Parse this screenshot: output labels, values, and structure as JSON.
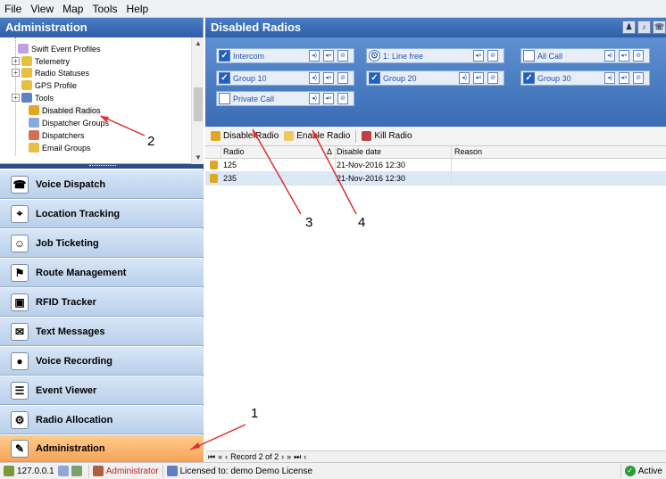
{
  "menu": [
    "File",
    "View",
    "Map",
    "Tools",
    "Help"
  ],
  "left_panel": {
    "title": "Administration",
    "tree": [
      {
        "label": "Swift Event Profiles",
        "icon": "event-profile-icon"
      },
      {
        "label": "Telemetry",
        "icon": "telemetry-icon"
      },
      {
        "label": "Radio Statuses",
        "icon": "radio-status-icon"
      },
      {
        "label": "GPS Profile",
        "icon": "gps-profile-icon"
      },
      {
        "label": "Tools",
        "icon": "tools-icon"
      },
      {
        "label": "Disabled Radios",
        "icon": "lock-icon"
      },
      {
        "label": "Dispatcher Groups",
        "icon": "dispatcher-groups-icon"
      },
      {
        "label": "Dispatchers",
        "icon": "dispatchers-icon"
      },
      {
        "label": "Email Groups",
        "icon": "email-groups-icon"
      }
    ],
    "nav": [
      {
        "label": "Voice Dispatch",
        "icon": "voice-dispatch-icon"
      },
      {
        "label": "Location Tracking",
        "icon": "location-tracking-icon"
      },
      {
        "label": "Job Ticketing",
        "icon": "job-ticketing-icon"
      },
      {
        "label": "Route Management",
        "icon": "route-management-icon"
      },
      {
        "label": "RFID Tracker",
        "icon": "rfid-icon"
      },
      {
        "label": "Text Messages",
        "icon": "envelope-icon"
      },
      {
        "label": "Voice Recording",
        "icon": "microphone-icon"
      },
      {
        "label": "Event Viewer",
        "icon": "event-viewer-icon"
      },
      {
        "label": "Radio Allocation",
        "icon": "radio-allocation-icon"
      },
      {
        "label": "Administration",
        "icon": "administration-icon"
      }
    ]
  },
  "right_panel": {
    "title": "Disabled Radios",
    "talk_groups": [
      {
        "label": "Intercom",
        "checked": true
      },
      {
        "label": "1: Line free",
        "checked": false
      },
      {
        "label": "All Call",
        "checked": false
      },
      {
        "label": "Group 10",
        "checked": true
      },
      {
        "label": "Group 20",
        "checked": true
      },
      {
        "label": "Group 30",
        "checked": true
      },
      {
        "label": "Private Call",
        "checked": false
      }
    ],
    "toolbar": {
      "disable": "Disable Radio",
      "enable": "Enable Radio",
      "kill": "Kill Radio"
    },
    "columns": {
      "radio": "Radio",
      "sort": "Δ",
      "date": "Disable date",
      "reason": "Reason"
    },
    "rows": [
      {
        "radio": "125",
        "date": "21-Nov-2016 12:30",
        "reason": ""
      },
      {
        "radio": "235",
        "date": "21-Nov-2016 12:30",
        "reason": ""
      }
    ],
    "pager": {
      "first": "⏮",
      "prev_page": "«",
      "prev": "‹",
      "record": "Record 2 of 2",
      "next": "›",
      "next_page": "»",
      "last": "⏭",
      "extra": "‹"
    }
  },
  "status": {
    "ip": "127.0.0.1",
    "user": "Administrator",
    "license": "Licensed to: demo Demo License",
    "state": "Active"
  },
  "annotations": [
    "1",
    "2",
    "3",
    "4"
  ],
  "colors": {
    "header_blue": "#2e5fa8",
    "nav_active": "#f7a45b",
    "annotation_red": "#e03030"
  }
}
